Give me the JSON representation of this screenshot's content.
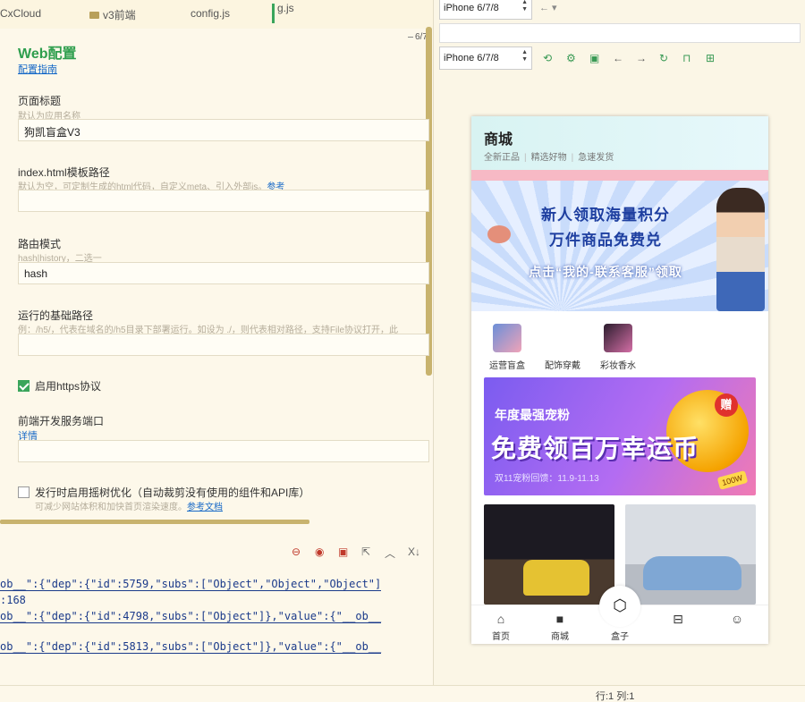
{
  "editor": {
    "tabs": [
      {
        "label": "CxCloud"
      },
      {
        "label": "v3前端"
      },
      {
        "label": "config.js"
      },
      {
        "label": "g.js"
      }
    ],
    "page_indicator": "6/7"
  },
  "form": {
    "title": "Web配置",
    "guide_link": "配置指南",
    "page_title": {
      "label": "页面标题",
      "hint": "默认为应用名称",
      "value": "狗凯盲盒V3"
    },
    "index_template": {
      "label": "index.html模板路径",
      "hint": "默认为空，可定制生成的html代码，自定义meta、引入外部js。",
      "hint_link": "参考",
      "value": ""
    },
    "router_mode": {
      "label": "路由模式",
      "hint": "hash|history，二选一",
      "value": "hash"
    },
    "base_path": {
      "label": "运行的基础路径",
      "hint": "例：/h5/，代表在域名的/h5目录下部署运行。如设为 ./，则代表相对路径，支持File协议打开，此",
      "value": ""
    },
    "https": {
      "label": "启用https协议",
      "checked": true
    },
    "dev_port": {
      "label": "前端开发服务端口",
      "link": "详情",
      "value": ""
    },
    "treeshake": {
      "label": "发行时启用摇树优化（自动裁剪没有使用的组件和API库）",
      "hint": "可减少网站体积和加快首页渲染速度。",
      "hint_link": "参考文档",
      "checked": false
    }
  },
  "console": {
    "lines": [
      "ob__\":{\"dep\":{\"id\":5759,\"subs\":[\"Object\",\"Object\",\"Object\"]",
      ":168",
      "ob__\":{\"dep\":{\"id\":4798,\"subs\":[\"Object\"]},\"value\":{\"__ob__",
      "ob__\":{\"dep\":{\"id\":5813,\"subs\":[\"Object\"]},\"value\":{\"__ob__"
    ],
    "status": "行:1  列:1"
  },
  "preview": {
    "device_top": "iPhone 6/7/8",
    "device": "iPhone 6/7/8",
    "shop": {
      "title": "商城",
      "tags": [
        "全新正品",
        "精选好物",
        "急速发货"
      ]
    },
    "banner": {
      "line1": "新人领取海量积分",
      "line2": "万件商品免费兑",
      "line3": "点击“我的-联系客服”领取"
    },
    "categories": [
      {
        "label": "运营盲盒"
      },
      {
        "label": "配饰穿戴"
      },
      {
        "label": "彩妆香水"
      }
    ],
    "promo": {
      "small": "年度最强宠粉",
      "big": "免费领百万幸运币",
      "date": "双11宠粉回馈：11.9-11.13",
      "gift": "赠",
      "badge": "100W"
    },
    "tabbar": [
      {
        "label": "首页",
        "icon": "home-icon"
      },
      {
        "label": "商城",
        "icon": "shop-icon"
      },
      {
        "label": "盒子",
        "icon": "box-icon"
      },
      {
        "label": "",
        "icon": "bag-icon"
      },
      {
        "label": "",
        "icon": "smile-icon"
      }
    ]
  },
  "colors": {
    "accent": "#2e9e4d",
    "link": "#1769c7",
    "console_text": "#1a3a8a"
  }
}
